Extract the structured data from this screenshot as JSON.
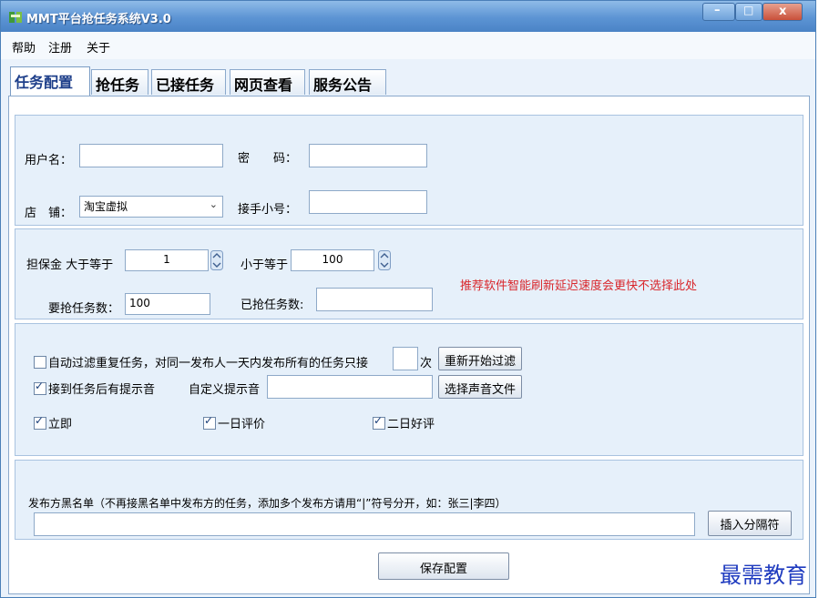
{
  "window": {
    "title": "MMT平台抢任务系统V3.0",
    "controls": {
      "minimize": "–",
      "maximize": "□",
      "close": "x"
    }
  },
  "menu": [
    "帮助",
    "注册",
    "关于"
  ],
  "tabs": [
    "任务配置",
    "抢任务",
    "已接任务",
    "网页查看",
    "服务公告"
  ],
  "account": {
    "username_label": "用户名：",
    "username_value": "",
    "password_label": "密　　码：",
    "password_value": "",
    "shop_label": "店　铺：",
    "shop_value": "淘宝虚拟",
    "receiver_label": "接手小号：",
    "receiver_value": ""
  },
  "deposit": {
    "label": "担保金 大于等于",
    "min_value": "1",
    "max_label": "小于等于",
    "max_value": "100",
    "notice": "推荐软件智能刷新延迟速度会更快不选择此处",
    "notice_color": "#d9262b",
    "tasks_label": "要抢任务数：",
    "tasks_value": "100",
    "grabbed_label": "已抢任务数:",
    "grabbed_value": ""
  },
  "options": {
    "auto_filter_label": "自动过滤重复任务，对同一发布人一天内发布所有的任务只接",
    "auto_filter_checked": false,
    "times_value": "",
    "times_suffix": "次",
    "restart_filter_button": "重新开始过滤",
    "sound_label": "接到任务后有提示音",
    "sound_checked": true,
    "custom_sound_label": "自定义提示音",
    "custom_sound_value": "",
    "choose_sound_button": "选择声音文件",
    "immediate_label": "立即",
    "immediate_checked": true,
    "one_day_label": "一日评价",
    "one_day_checked": true,
    "two_day_label": "二日好评",
    "two_day_checked": true
  },
  "blacklist": {
    "label": "发布方黑名单（不再接黑名单中发布方的任务，添加多个发布方请用“|”符号分开，如：张三|李四）",
    "value": "",
    "insert_button": "插入分隔符"
  },
  "save_button": "保存配置",
  "watermark": "最需教育"
}
